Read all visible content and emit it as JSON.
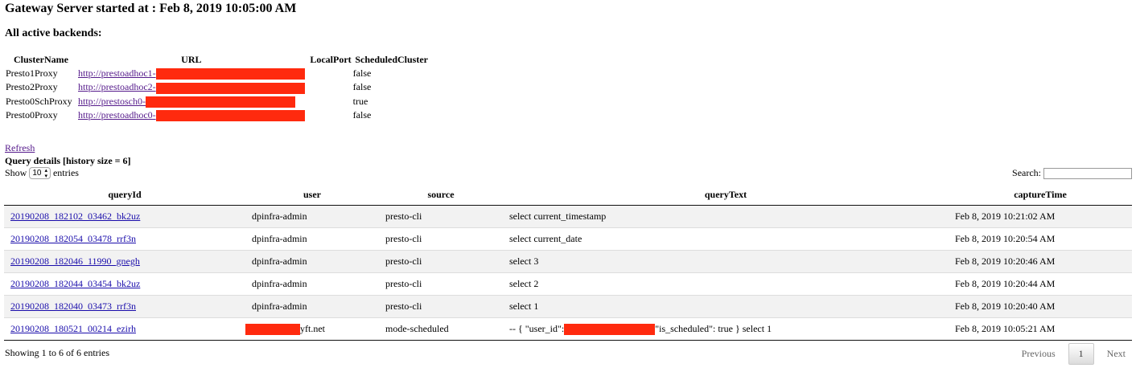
{
  "header": {
    "title": "Gateway Server started at : Feb 8, 2019 10:05:00 AM",
    "backends_heading": "All active backends:"
  },
  "backends": {
    "columns": [
      "ClusterName",
      "URL",
      "LocalPort",
      "ScheduledCluster"
    ],
    "rows": [
      {
        "name": "Presto1Proxy",
        "url": "http://prestoadhoc1-",
        "scheduled": "false"
      },
      {
        "name": "Presto2Proxy",
        "url": "http://prestoadhoc2-",
        "scheduled": "false"
      },
      {
        "name": "Presto0SchProxy",
        "url": "http://prestosch0-",
        "scheduled": "true"
      },
      {
        "name": "Presto0Proxy",
        "url": "http://prestoadhoc0-",
        "scheduled": "false"
      }
    ]
  },
  "refresh_label": "Refresh",
  "query_details": {
    "title": "Query details [history size = 6]",
    "show_prefix": "Show",
    "page_size": "10",
    "show_suffix": "entries",
    "search_label": "Search:",
    "search_value": "",
    "columns": [
      "queryId",
      "user",
      "source",
      "queryText",
      "captureTime"
    ],
    "rows": [
      {
        "queryId": "20190208_182102_03462_bk2uz",
        "user": "dpinfra-admin",
        "source": "presto-cli",
        "queryText": "select current_timestamp",
        "captureTime": "Feb 8, 2019 10:21:02 AM"
      },
      {
        "queryId": "20190208_182054_03478_rrf3n",
        "user": "dpinfra-admin",
        "source": "presto-cli",
        "queryText": "select current_date",
        "captureTime": "Feb 8, 2019 10:20:54 AM"
      },
      {
        "queryId": "20190208_182046_11990_gnegh",
        "user": "dpinfra-admin",
        "source": "presto-cli",
        "queryText": "select 3",
        "captureTime": "Feb 8, 2019 10:20:46 AM"
      },
      {
        "queryId": "20190208_182044_03454_bk2uz",
        "user": "dpinfra-admin",
        "source": "presto-cli",
        "queryText": "select 2",
        "captureTime": "Feb 8, 2019 10:20:44 AM"
      },
      {
        "queryId": "20190208_182040_03473_rrf3n",
        "user": "dpinfra-admin",
        "source": "presto-cli",
        "queryText": "select 1",
        "captureTime": "Feb 8, 2019 10:20:40 AM"
      },
      {
        "queryId": "20190208_180521_00214_ezirh",
        "user_suffix": "yft.net",
        "source": "mode-scheduled",
        "queryText_prefix": "-- { \"user_id\":",
        "queryText_suffix": "\"is_scheduled\": true } select 1",
        "captureTime": "Feb 8, 2019 10:05:21 AM"
      }
    ],
    "info": "Showing 1 to 6 of 6 entries",
    "pagination": {
      "previous": "Previous",
      "current_page": "1",
      "next": "Next"
    }
  },
  "colors": {
    "redaction": "#ff2a0e",
    "link": "#1a0dab",
    "visited_link": "#551a8b",
    "stripe": "#f2f2f2"
  }
}
